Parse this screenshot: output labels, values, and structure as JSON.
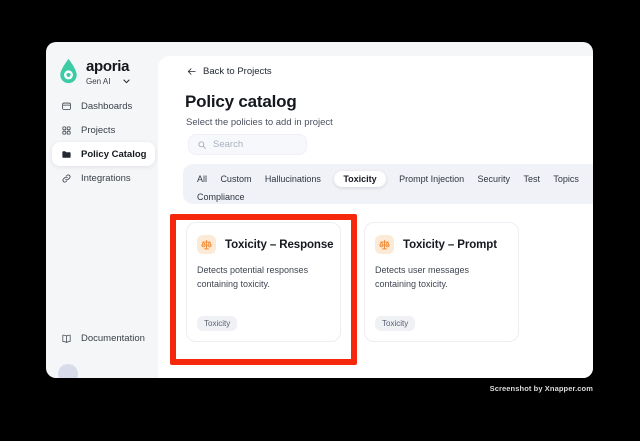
{
  "app": {
    "brand": "aporia",
    "workspace": "Gen AI"
  },
  "sidebar": {
    "items": [
      {
        "label": "Dashboards",
        "icon": "dashboard-icon"
      },
      {
        "label": "Projects",
        "icon": "grid-icon"
      },
      {
        "label": "Policy Catalog",
        "icon": "folder-icon",
        "active": true
      },
      {
        "label": "Integrations",
        "icon": "link-icon"
      }
    ],
    "footer_item": {
      "label": "Documentation",
      "icon": "book-icon"
    }
  },
  "main": {
    "back_link": "Back to Projects",
    "title": "Policy catalog",
    "subtitle": "Select the policies to add in project",
    "search": {
      "placeholder": "Search"
    },
    "tabs": [
      "All",
      "Custom",
      "Hallucinations",
      "Toxicity",
      "Prompt Injection",
      "Security",
      "Test",
      "Topics",
      "Compliance"
    ],
    "active_tab": "Toxicity",
    "cards": [
      {
        "title": "Toxicity – Response",
        "description": "Detects potential responses containing toxicity.",
        "tag": "Toxicity",
        "icon": "scales-icon",
        "highlighted": true
      },
      {
        "title": "Toxicity – Prompt",
        "description": "Detects user messages containing toxicity.",
        "tag": "Toxicity",
        "icon": "scales-icon",
        "highlighted": false
      }
    ]
  },
  "watermark": "Screenshot by Xnapper.com",
  "colors": {
    "highlight_red": "#F5280C",
    "brand_teal": "#3DCBA6",
    "icon_orange": "#F18A34",
    "icon_bg_orange": "#FCE9D6",
    "window_bg": "#F5F6F8",
    "tabs_bg": "#F1F2F7"
  },
  "icons": {
    "logo": "droplet-icon",
    "nav": [
      "dashboard-icon",
      "grid-icon",
      "folder-icon",
      "link-icon",
      "book-icon"
    ],
    "other": [
      "chevron-down-icon",
      "arrow-left-icon",
      "search-icon",
      "scales-icon"
    ]
  }
}
